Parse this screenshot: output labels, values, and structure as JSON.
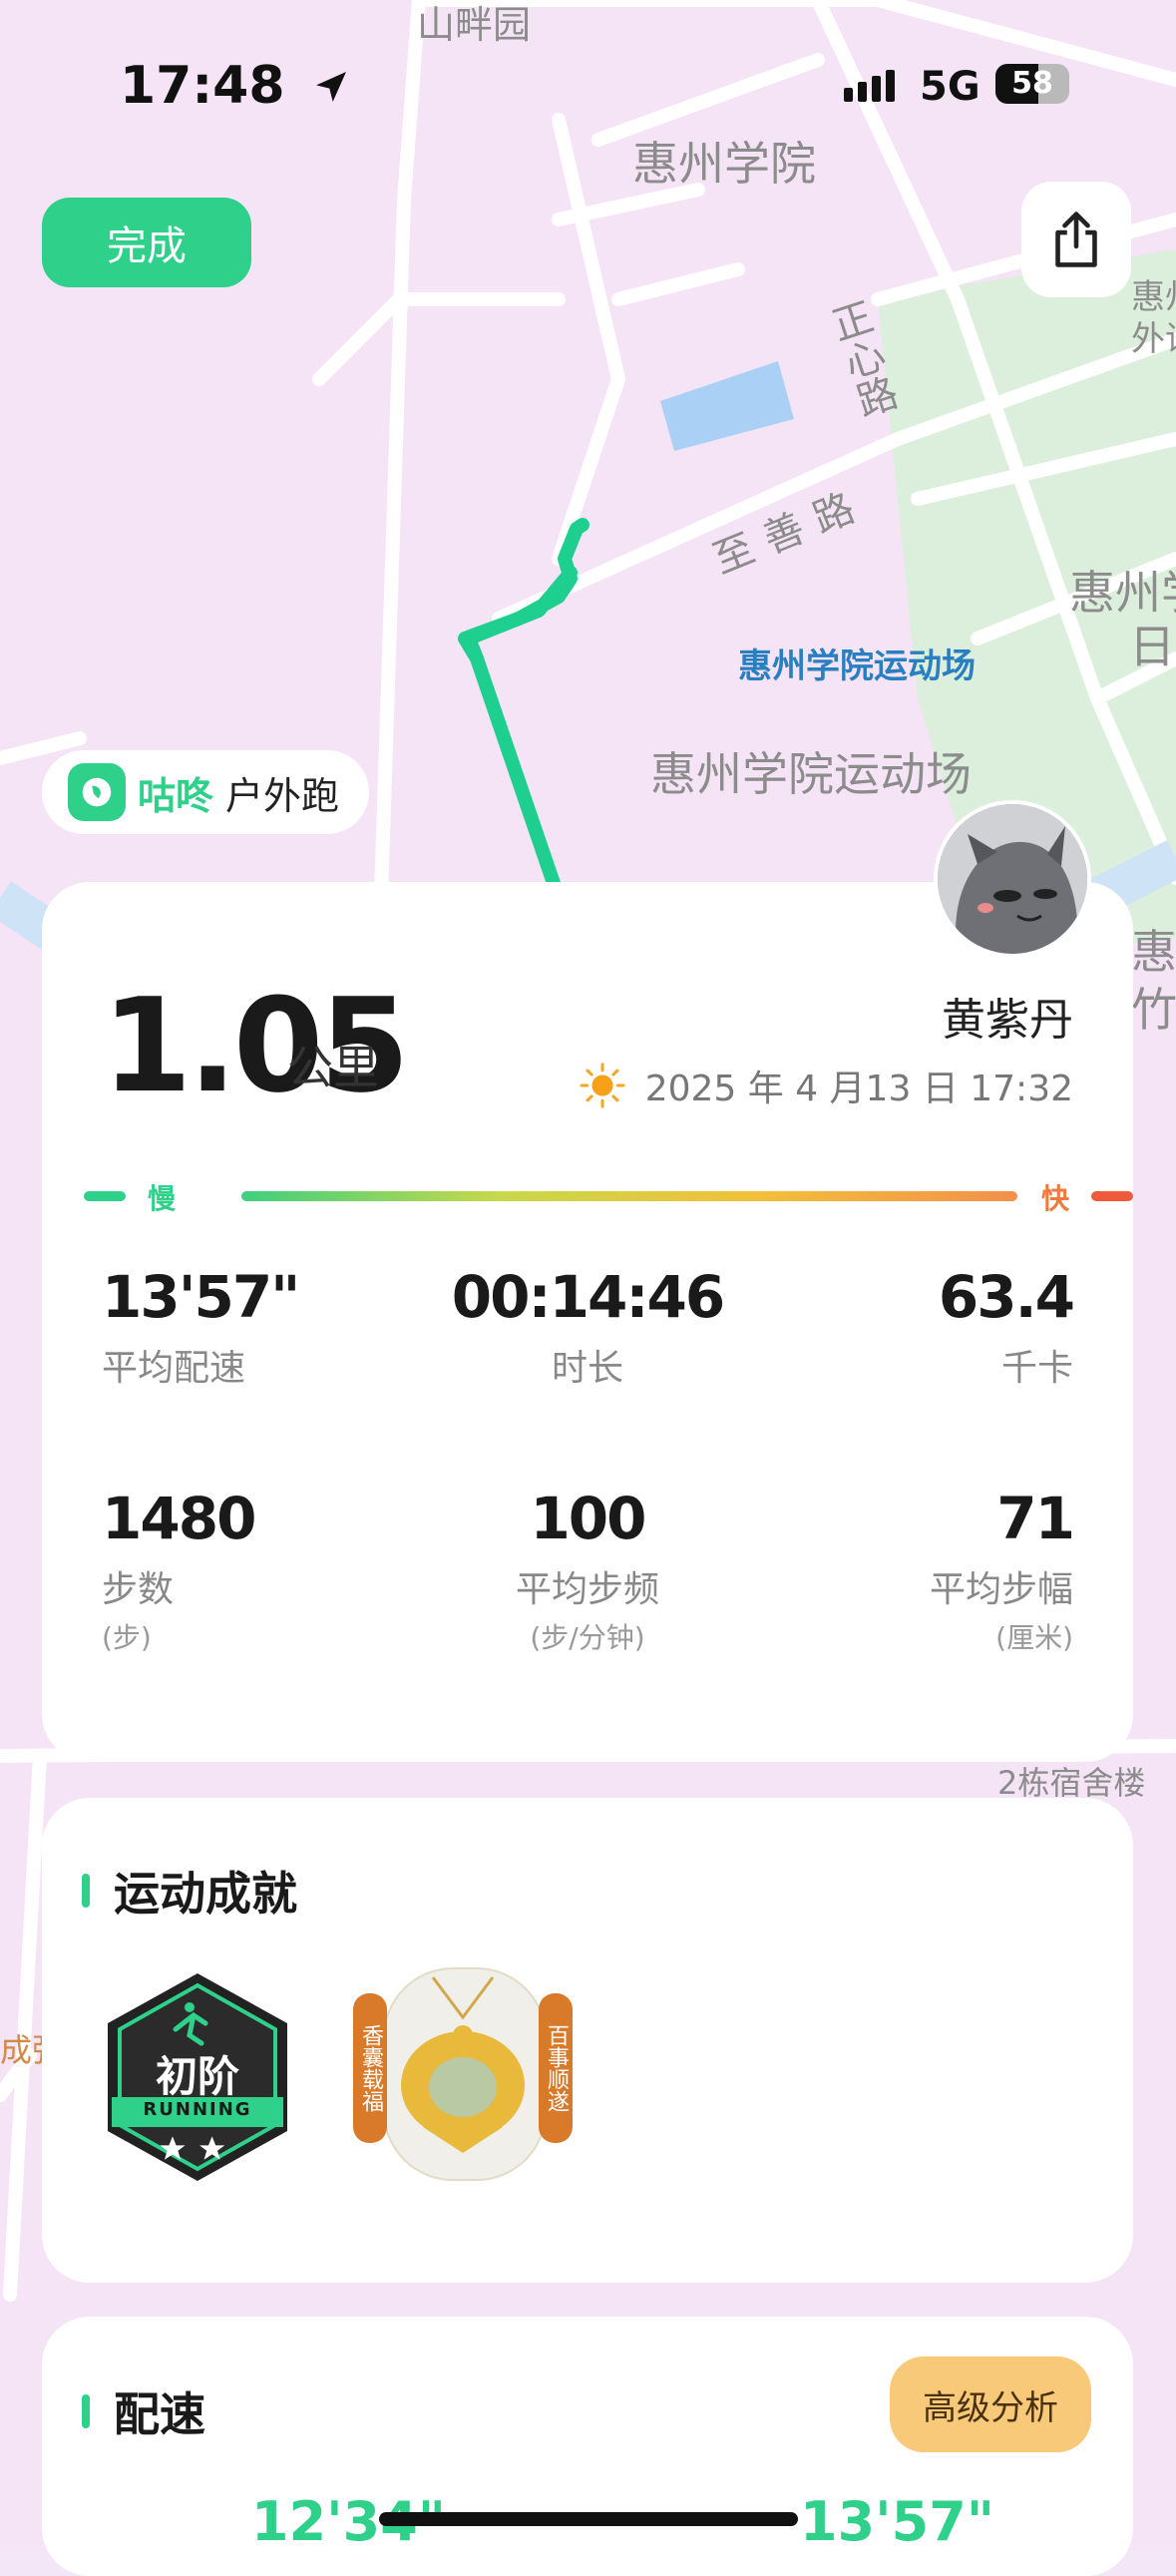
{
  "status_bar": {
    "time": "17:48",
    "network": "5G",
    "battery": "58"
  },
  "header": {
    "done_label": "完成",
    "share_icon": "share-icon"
  },
  "map": {
    "labels": [
      "山畔园",
      "惠州学院",
      "正心路",
      "至善路",
      "惠州学院运动场",
      "惠州学院运动场",
      "2栋宿舍楼",
      "惠州",
      "外语",
      "惠州学",
      "日",
      "惠",
      "竹",
      "成弥"
    ],
    "route_color": "#1fcf8f"
  },
  "activity_tag": {
    "brand": "咕咚",
    "type": "户外跑"
  },
  "summary": {
    "distance": "1.05",
    "distance_unit": "公里",
    "user_name": "黄紫丹",
    "date": "2025 年 4 月13 日 17:32",
    "pace_slow": "慢",
    "pace_fast": "快",
    "stats": [
      {
        "value": "13'57\"",
        "label": "平均配速",
        "unit": ""
      },
      {
        "value": "00:14:46",
        "label": "时长",
        "unit": ""
      },
      {
        "value": "63.4",
        "label": "千卡",
        "unit": ""
      },
      {
        "value": "1480",
        "label": "步数",
        "unit": "(步)"
      },
      {
        "value": "100",
        "label": "平均步频",
        "unit": "(步/分钟)"
      },
      {
        "value": "71",
        "label": "平均步幅",
        "unit": "(厘米)"
      }
    ]
  },
  "achievements": {
    "title": "运动成就",
    "badge1": {
      "text": "初阶",
      "sub": "RUNNING"
    },
    "badge2": {
      "left": "香囊载福",
      "right": "百事顺遂"
    }
  },
  "pace": {
    "title": "配速",
    "advanced_label": "高级分析",
    "fastest": "12'34\"",
    "average": "13'57\""
  },
  "colors": {
    "accent": "#2ed08a",
    "slow": "#2ed08a",
    "fast": "#f05a3c"
  }
}
